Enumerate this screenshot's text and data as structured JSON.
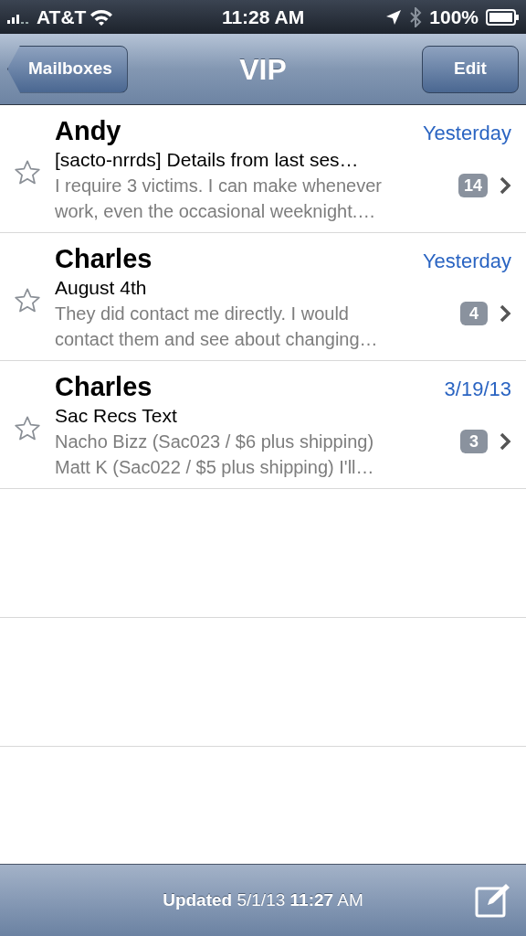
{
  "status_bar": {
    "carrier": "AT&T",
    "time": "11:28 AM",
    "battery": "100%"
  },
  "nav_bar": {
    "back": "Mailboxes",
    "title": "VIP",
    "action": "Edit"
  },
  "messages": [
    {
      "sender": "Andy",
      "date": "Yesterday",
      "date_highlighted": true,
      "subject": "[sacto-nrrds] Details from last ses…",
      "preview_lines": [
        "I require 3 victims. I can make whenever",
        "work, even the occasional weeknight.…"
      ],
      "count": "14",
      "starred": false
    },
    {
      "sender": "Charles",
      "date": "Yesterday",
      "date_highlighted": true,
      "subject": "August 4th",
      "preview_lines": [
        "They did contact me directly. I would",
        "contact them and see about changing…"
      ],
      "count": "4",
      "starred": false
    },
    {
      "sender": "Charles",
      "date": "3/19/13",
      "date_highlighted": true,
      "subject": "Sac Recs Text",
      "preview_lines": [
        "Nacho Bizz (Sac023 / $6 plus shipping)",
        "Matt K (Sac022 / $5 plus shipping) I'll…"
      ],
      "count": "3",
      "starred": false
    }
  ],
  "toolbar": {
    "status": "**Updated** 5/1/13 **11:27** AM"
  }
}
